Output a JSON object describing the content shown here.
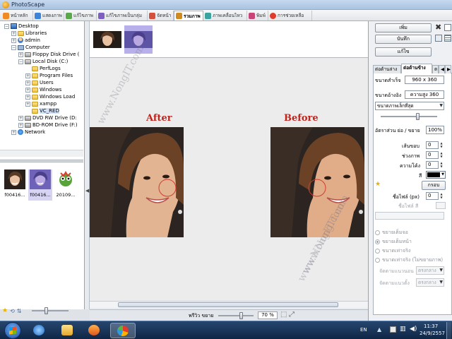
{
  "window": {
    "title": "PhotoScape"
  },
  "tabs": [
    {
      "label": "หน้าหลัก",
      "icon": "home-icon",
      "color": "#f08a24"
    },
    {
      "label": "แสดงภาพ",
      "icon": "viewer-icon",
      "color": "#3c84d8"
    },
    {
      "label": "แก้ไขภาพ",
      "icon": "editor-icon",
      "color": "#5aa84b"
    },
    {
      "label": "แก้ไขภาพเป็นกลุ่ม",
      "icon": "batch-editor-icon",
      "color": "#7d5fc0"
    },
    {
      "label": "จัดหน้า",
      "icon": "page-icon",
      "color": "#d64f3c"
    },
    {
      "label": "รวมภาพ",
      "icon": "combine-icon",
      "color": "#d08a1e"
    },
    {
      "label": "ภาพเคลื่อนไหว",
      "icon": "animated-gif-icon",
      "color": "#3aa3a0"
    },
    {
      "label": "พิมพ์",
      "icon": "print-icon",
      "color": "#c8457a"
    },
    {
      "label": "การช่วยเหลือ",
      "icon": "help-icon",
      "color": "#e03a2a"
    }
  ],
  "tree": [
    {
      "label": "Desktop",
      "icon": "desktop-icon",
      "exp": "−"
    },
    {
      "label": "Libraries",
      "icon": "folder-icon",
      "exp": "+"
    },
    {
      "label": "admin",
      "icon": "user-icon",
      "exp": "+"
    },
    {
      "label": "Computer",
      "icon": "computer-icon",
      "exp": "−"
    },
    {
      "label": "Floppy Disk Drive (",
      "icon": "drive-icon",
      "exp": "+"
    },
    {
      "label": "Local Disk (C:)",
      "icon": "drive-icon",
      "exp": "−"
    },
    {
      "label": "PerfLogs",
      "icon": "folder-icon",
      "exp": ""
    },
    {
      "label": "Program Files",
      "icon": "folder-icon",
      "exp": "+"
    },
    {
      "label": "Users",
      "icon": "folder-icon",
      "exp": "+"
    },
    {
      "label": "Windows",
      "icon": "folder-icon",
      "exp": "+"
    },
    {
      "label": "Windows Load",
      "icon": "folder-icon",
      "exp": "+"
    },
    {
      "label": "xampp",
      "icon": "folder-icon",
      "exp": "+"
    },
    {
      "label": "VC_RED",
      "icon": "folder-icon",
      "exp": ""
    },
    {
      "label": "DVD RW Drive (D:",
      "icon": "drive-icon",
      "exp": "+"
    },
    {
      "label": "BD-ROM Drive (F:)",
      "icon": "drive-icon",
      "exp": "+"
    },
    {
      "label": "Network",
      "icon": "network-icon",
      "exp": "+"
    }
  ],
  "file_thumbs": [
    {
      "label": "f00416..."
    },
    {
      "label": "f00416..."
    },
    {
      "label": "20109..."
    }
  ],
  "canvas": {
    "after_label": "After",
    "before_label": "Before",
    "watermark_top": "www.NongIT.com",
    "watermark_mid": "www.NongIT.com",
    "watermark_right": "www.NongIT.com"
  },
  "statusbar": {
    "preview_label": "พรีวิว ขยาย",
    "zoom": "70 %"
  },
  "right": {
    "add_button": "เพิ่ม",
    "save_button": "บันทึก",
    "edit_button": "แก้ไข",
    "tabs": [
      "ต่อด้านล่าง",
      "ต่อด้านข้าง",
      "ต"
    ],
    "final_size_label": "ขนาดสำเร็จ",
    "final_size_value": "960 x 360",
    "width_label": "ขนาดอ้างอิง",
    "width_value": "ความสูง 360",
    "fit_select": "ขนาดภาพเล็กที่สุด",
    "ratio_label": "อัตราส่วน ย่อ / ขยาย",
    "ratio_value": "100%",
    "margin_label": "เส้นขอบ",
    "margin_value": "0",
    "spacing_label": "ช่วงภาพ",
    "spacing_value": "0",
    "round_label": "ความโค้ง",
    "round_value": "0",
    "color_label": "สี",
    "color_swatch": "#000000",
    "frame_button": "กรอบ",
    "filename_label": "ชื่อไฟล์ (px)",
    "filename_value": "0",
    "filename_color_label": "ชื่อไฟล์ สี",
    "radio_1": "ขยายเต็มจอ",
    "radio_2": "ขยายเต็มหน้า",
    "radio_3": "ขนาดเท่าจริง",
    "radio_4": "ขนาดเท่าจริง (ไม่ขยายภาพ)",
    "halign_label": "จัดตามแนวนอน",
    "halign_value": "ตรงกลาง",
    "valign_label": "จัดตามแนวตั้ง",
    "valign_value": "ตรงกลาง"
  },
  "taskbar": {
    "lang": "EN",
    "time": "11:37",
    "date": "24/9/2557"
  }
}
